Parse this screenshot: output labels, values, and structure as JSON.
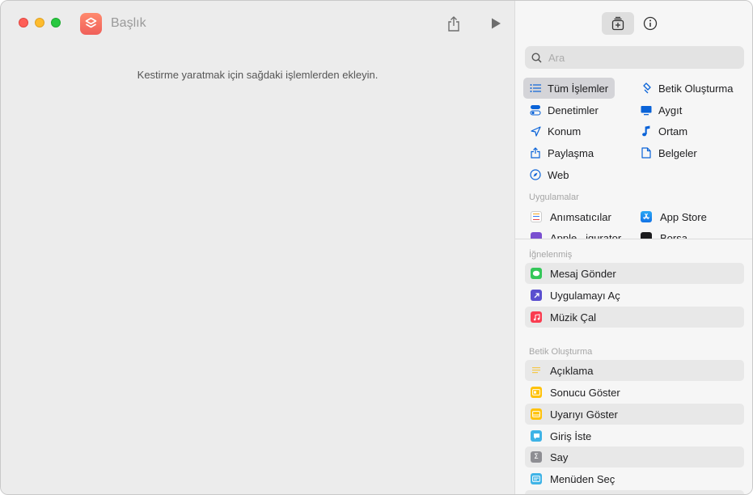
{
  "window": {
    "title": "Başlık",
    "empty_hint": "Kestirme yaratmak için sağdaki işlemlerden ekleyin."
  },
  "search": {
    "placeholder": "Ara",
    "value": ""
  },
  "categories": [
    {
      "label": "Tüm İşlemler",
      "icon": "list-icon",
      "selected": true
    },
    {
      "label": "Betik Oluşturma",
      "icon": "scripting-icon"
    },
    {
      "label": "Denetimler",
      "icon": "toggles-icon"
    },
    {
      "label": "Aygıt",
      "icon": "display-icon"
    },
    {
      "label": "Konum",
      "icon": "location-arrow-icon"
    },
    {
      "label": "Ortam",
      "icon": "music-note-icon"
    },
    {
      "label": "Paylaşma",
      "icon": "share-icon"
    },
    {
      "label": "Belgeler",
      "icon": "document-icon"
    },
    {
      "label": "Web",
      "icon": "compass-icon"
    }
  ],
  "apps_section": {
    "label": "Uygulamalar",
    "items": [
      {
        "label": "Anımsatıcılar",
        "icon": "reminders-icon"
      },
      {
        "label": "App Store",
        "icon": "app-store-icon"
      },
      {
        "label": "Apple...igurator",
        "icon": "apple-configurator-icon"
      },
      {
        "label": "Borsa",
        "icon": "stocks-icon"
      }
    ]
  },
  "pinned_section": {
    "label": "İğnelenmiş",
    "items": [
      {
        "label": "Mesaj Gönder",
        "icon": "messages-icon",
        "color": "#34c759"
      },
      {
        "label": "Uygulamayı Aç",
        "icon": "open-app-icon",
        "color": "#5a4fcf"
      },
      {
        "label": "Müzik Çal",
        "icon": "music-icon",
        "color": "#fa3c50"
      }
    ]
  },
  "scripting_section": {
    "label": "Betik Oluşturma",
    "items": [
      {
        "label": "Açıklama",
        "icon": "comment-icon",
        "color": "#f5d76e"
      },
      {
        "label": "Sonucu Göster",
        "icon": "show-result-icon",
        "color": "#ffc20a"
      },
      {
        "label": "Uyarıyı Göster",
        "icon": "show-alert-icon",
        "color": "#ffc20a"
      },
      {
        "label": "Giriş İste",
        "icon": "ask-input-icon",
        "color": "#3fb3e6"
      },
      {
        "label": "Say",
        "icon": "count-icon",
        "color": "#8e8e93"
      },
      {
        "label": "Menüden Seç",
        "icon": "choose-menu-icon",
        "color": "#3fb3e6"
      }
    ]
  },
  "colors": {
    "accent": "#0a63d8",
    "selected_bg": "#d4d4d8"
  }
}
